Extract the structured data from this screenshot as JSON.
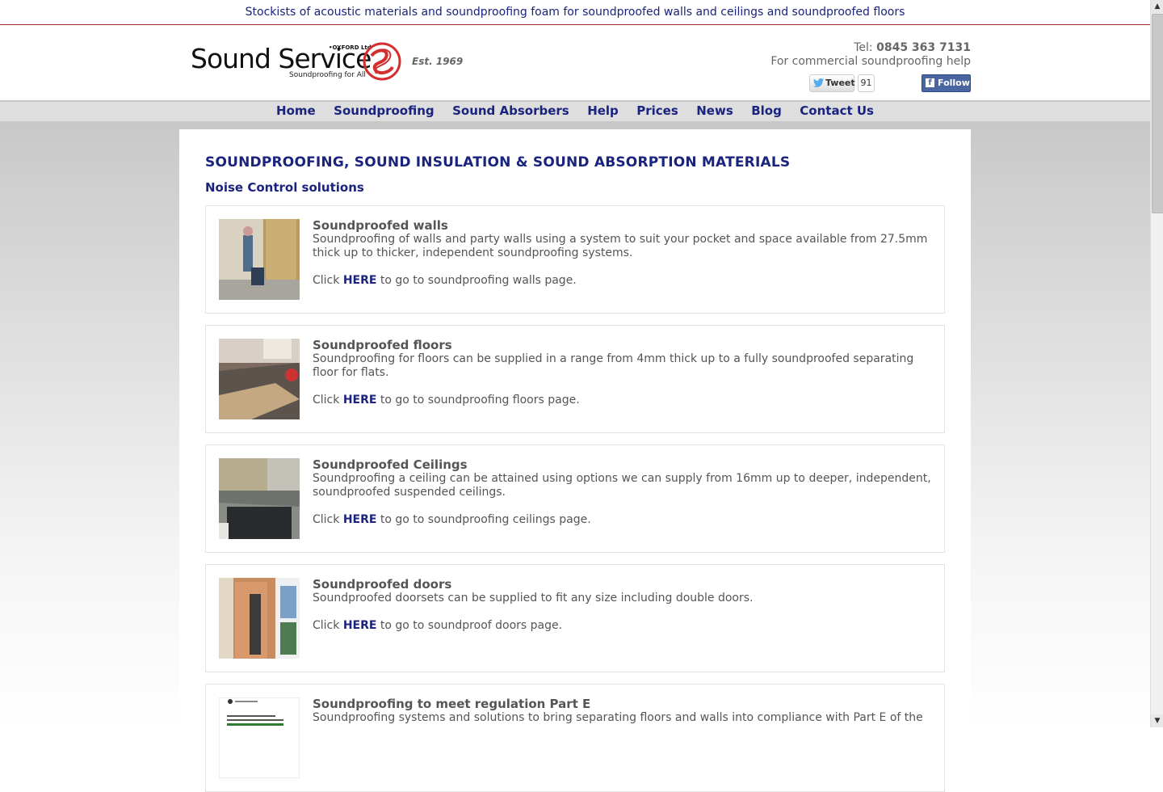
{
  "top_banner": "Stockists of acoustic materials and soundproofing foam for soundproofed walls and ceilings and soundproofed floors",
  "logo": {
    "word": "Sound Service",
    "oxford": "•OXFORD Ltd",
    "tagline": "Soundproofing for All",
    "est": "Est. 1969"
  },
  "contact": {
    "tel_label": "Tel: ",
    "tel_number": "0845 363 7131",
    "commercial": "For commercial soundproofing help"
  },
  "social": {
    "tweet_label": "Tweet",
    "tweet_count": "91",
    "follow_label": "Follow"
  },
  "nav": [
    "Home",
    "Soundproofing",
    "Sound Absorbers",
    "Help",
    "Prices",
    "News",
    "Blog",
    "Contact Us"
  ],
  "page": {
    "title": "SOUNDPROOFING, SOUND INSULATION & SOUND ABSORPTION MATERIALS",
    "subtitle": "Noise Control solutions"
  },
  "cards": [
    {
      "title": "Soundproofed walls",
      "desc": "Soundproofing of walls and party walls using a system to suit your pocket and space available from 27.5mm thick up to thicker, independent soundproofing systems.",
      "click_pre": "Click ",
      "link": "HERE",
      "click_post": " to go to soundproofing walls page."
    },
    {
      "title": "Soundproofed floors",
      "desc": "Soundproofing for floors can be supplied in a range from 4mm thick up to a fully soundproofed separating floor for flats.",
      "click_pre": "Click ",
      "link": "HERE",
      "click_post": " to go to soundproofing floors page."
    },
    {
      "title": "Soundproofed Ceilings",
      "desc": "Soundproofing a ceiling can be attained using options we can supply from 16mm up to deeper, independent, soundproofed suspended ceilings.",
      "click_pre": "Click ",
      "link": "HERE",
      "click_post": " to go to soundproofing ceilings page."
    },
    {
      "title": "Soundproofed doors",
      "desc": "Soundproofed doorsets can be supplied to fit any size including double doors.",
      "click_pre": "Click ",
      "link": "HERE",
      "click_post": " to go to soundproof doors page."
    },
    {
      "title": "Soundproofing to meet regulation Part E",
      "desc": "Soundproofing systems and solutions to bring separating floors and walls into compliance with Part E of the",
      "click_pre": "",
      "link": "",
      "click_post": ""
    }
  ],
  "colors": {
    "nav_text": "#1a237e",
    "banner_rule": "#9b2b25",
    "logo_red": "#d32f2f"
  }
}
